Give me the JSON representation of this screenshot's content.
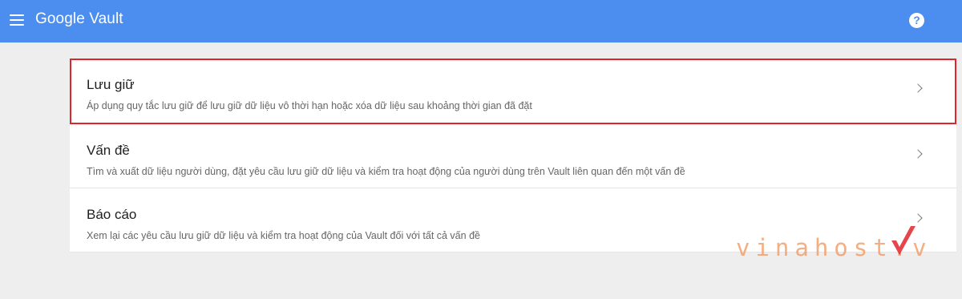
{
  "header": {
    "app_title": "Google Vault",
    "menu_icon": "menu-icon",
    "help_icon_glyph": "?",
    "bar_color": "#4b8ef0"
  },
  "cards": [
    {
      "title": "Lưu giữ",
      "description": "Áp dụng quy tắc lưu giữ để lưu giữ dữ liệu vô thời hạn hoặc xóa dữ liệu sau khoảng thời gian đã đặt",
      "highlighted": true
    },
    {
      "title": "Vấn đề",
      "description": "Tìm và xuất dữ liệu người dùng, đặt yêu cầu lưu giữ dữ liệu và kiểm tra hoạt động của người dùng trên Vault liên quan đến một vấn đề",
      "highlighted": false
    },
    {
      "title": "Báo cáo",
      "description": "Xem lại các yêu cầu lưu giữ dữ liệu và kiểm tra hoạt động của Vault đối với tất cả vấn đề",
      "highlighted": false
    }
  ],
  "watermark": {
    "text": "vinahost.v",
    "text_color": "#f2a06d",
    "check_color": "#e0242b"
  }
}
